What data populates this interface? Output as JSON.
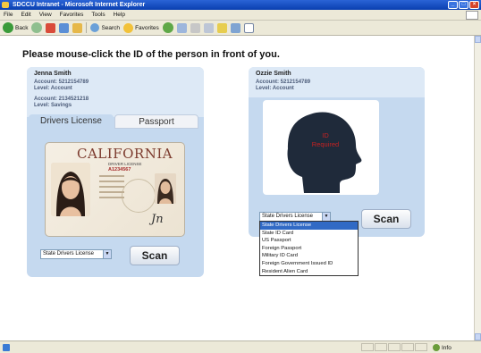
{
  "window": {
    "title": "SDCCU Intranet - Microsoft Internet Explorer"
  },
  "menu": [
    "File",
    "Edit",
    "View",
    "Favorites",
    "Tools",
    "Help"
  ],
  "toolbar": {
    "back": "Back",
    "search": "Search",
    "favorites": "Favorites"
  },
  "page": {
    "instruction": "Please mouse-click the ID of the person in front of you."
  },
  "left_person": {
    "name": "Jenna Smith",
    "accounts": [
      {
        "account_label": "Account:",
        "account": "5212154789",
        "level_label": "Level:",
        "level": "Account"
      },
      {
        "account_label": "Account:",
        "account": "2134521218",
        "level_label": "Level:",
        "level": "Savings"
      }
    ],
    "tabs": [
      "Drivers License",
      "Passport"
    ],
    "license": {
      "state": "CALIFORNIA",
      "subtitle": "DRIVER LICENSE",
      "number": "A1234567"
    },
    "select_value": "State Drivers License",
    "scan_label": "Scan"
  },
  "right_person": {
    "name": "Ozzie Smith",
    "account_label": "Account:",
    "account": "5212154789",
    "level_label": "Level:",
    "level": "Account",
    "id_line1": "ID",
    "id_line2": "Required",
    "select_value": "State Drivers License",
    "scan_label": "Scan",
    "options": [
      "State Drivers License",
      "State ID Card",
      "US Passport",
      "Foreign Passport",
      "Military ID Card",
      "Foreign Government Issued ID",
      "Resident Alien Card"
    ]
  },
  "status": {
    "zone": "Info"
  }
}
